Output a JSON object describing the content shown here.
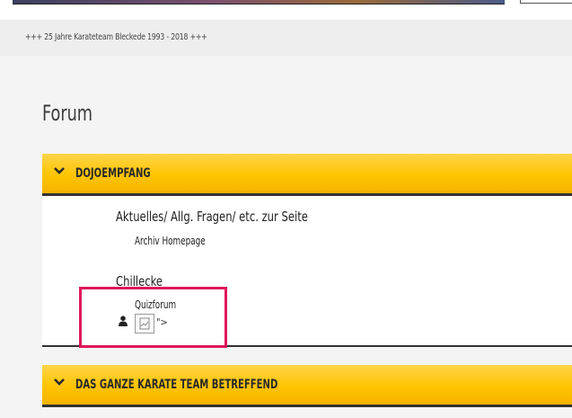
{
  "ticker": {
    "text": "+++ 25 Jahre Karateteam Bleckede 1993 - 2018 +++"
  },
  "page": {
    "title": "Forum"
  },
  "categories": [
    {
      "title": "DOJOEMPFANG",
      "forums": [
        {
          "title": "Aktuelles/ Allg. Fragen/ etc. zur Seite",
          "subforum": "Archiv Homepage"
        },
        {
          "title": "Chillecke",
          "subforum": "Quizforum",
          "trailing_text": "\">"
        }
      ]
    },
    {
      "title": "DAS GANZE KARATE TEAM BETREFFEND"
    }
  ],
  "colors": {
    "header_gold": "#ffc400",
    "highlight": "#e0185a",
    "divider": "#333333"
  }
}
